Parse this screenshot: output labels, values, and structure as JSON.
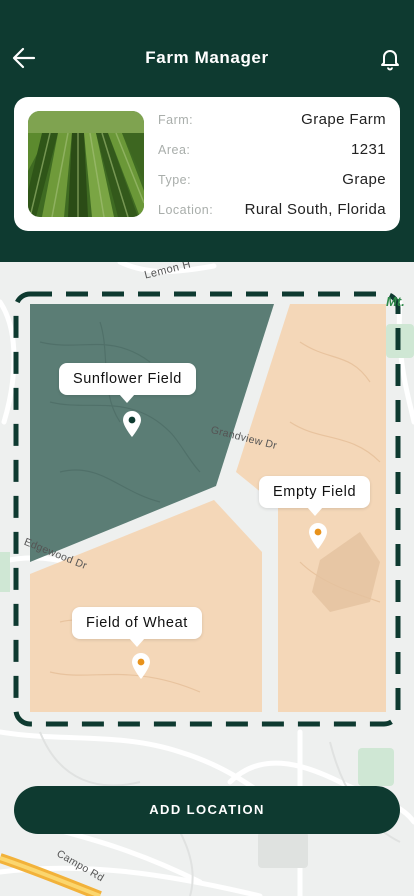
{
  "header": {
    "title": "Farm Manager"
  },
  "farm": {
    "fields": [
      {
        "key": "Farm:",
        "value": "Grape Farm"
      },
      {
        "key": "Area:",
        "value": "1231"
      },
      {
        "key": "Type:",
        "value": "Grape"
      },
      {
        "key": "Location:",
        "value": "Rural South, Florida"
      }
    ]
  },
  "map": {
    "streets": {
      "lemon": "Lemon H",
      "grandview": "Grandview Dr",
      "edgewood": "Edgewood Dr",
      "campo": "Campo Rd",
      "mt": "Mt."
    },
    "fields": {
      "sunflower": "Sunflower Field",
      "empty": "Empty Field",
      "wheat": "Field of Wheat"
    }
  },
  "actions": {
    "add_location": "ADD LOCATION"
  },
  "colors": {
    "primary": "#0e3a30",
    "field_tan": "#f4d7b8",
    "field_green": "#5b7d75",
    "pin_orange": "#e8921b"
  }
}
